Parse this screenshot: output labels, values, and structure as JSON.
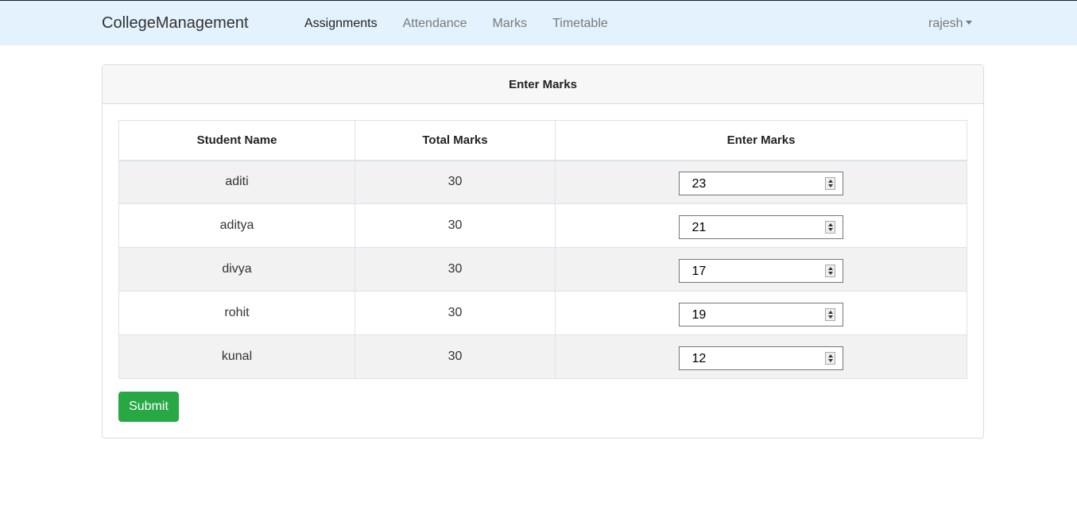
{
  "navbar": {
    "brand": "CollegeManagement",
    "links": [
      {
        "label": "Assignments",
        "active": true
      },
      {
        "label": "Attendance",
        "active": false
      },
      {
        "label": "Marks",
        "active": false
      },
      {
        "label": "Timetable",
        "active": false
      }
    ],
    "user": "rajesh"
  },
  "card": {
    "title": "Enter Marks",
    "columns": [
      "Student Name",
      "Total Marks",
      "Enter Marks"
    ],
    "rows": [
      {
        "name": "aditi",
        "total": "30",
        "marks": "23"
      },
      {
        "name": "aditya",
        "total": "30",
        "marks": "21"
      },
      {
        "name": "divya",
        "total": "30",
        "marks": "17"
      },
      {
        "name": "rohit",
        "total": "30",
        "marks": "19"
      },
      {
        "name": "kunal",
        "total": "30",
        "marks": "12"
      }
    ],
    "submit_label": "Submit"
  },
  "colors": {
    "navbar_bg": "#e3f2fd",
    "submit_bg": "#28a745"
  }
}
